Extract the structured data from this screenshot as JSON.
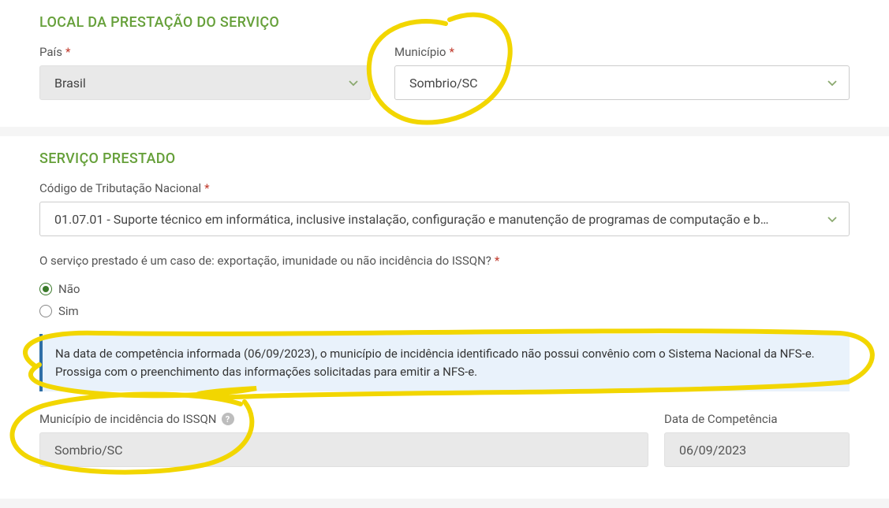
{
  "local": {
    "title": "LOCAL DA PRESTAÇÃO DO SERVIÇO",
    "pais_label": "País",
    "pais_value": "Brasil",
    "municipio_label": "Município",
    "municipio_value": "Sombrio/SC"
  },
  "servico": {
    "title": "SERVIÇO PRESTADO",
    "codigo_label": "Código de Tributação Nacional",
    "codigo_value": "01.07.01 - Suporte técnico em informática, inclusive instalação, configuração e manutenção de programas de computação e b…",
    "issqn_question": "O serviço prestado é um caso de: exportação, imunidade ou não incidência do ISSQN?",
    "radio_nao": "Não",
    "radio_sim": "Sim",
    "alert_text": "Na data de competência informada (06/09/2023), o município de incidência identificado não possui convênio com o Sistema Nacional da NFS-e. Prossiga com o preenchimento das informações solicitadas para emitir a NFS-e.",
    "mi_label": "Município de incidência do ISSQN",
    "mi_value": "Sombrio/SC",
    "dc_label": "Data de Competência",
    "dc_value": "06/09/2023"
  }
}
